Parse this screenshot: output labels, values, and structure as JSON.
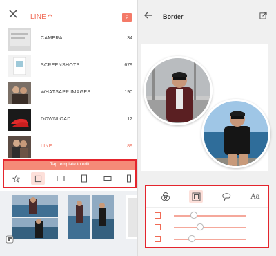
{
  "left": {
    "header": {
      "title": "LINE",
      "badge": "2",
      "close_icon": "close-icon",
      "caret_icon": "chevron-up-icon"
    },
    "albums": [
      {
        "name": "CAMERA",
        "count": "34",
        "thumb": "camera-thumbnail"
      },
      {
        "name": "SCREENSHOTS",
        "count": "679",
        "thumb": "screenshot-thumbnail"
      },
      {
        "name": "WHATSAPP IMAGES",
        "count": "190",
        "thumb": "whatsapp-thumbnail"
      },
      {
        "name": "DOWNLOAD",
        "count": "12",
        "thumb": "download-thumbnail"
      },
      {
        "name": "LINE",
        "count": "89",
        "thumb": "line-thumbnail",
        "active": true
      }
    ],
    "template_bar": "Tap template to edit",
    "template_icons": [
      "star-icon",
      "square-frame-icon",
      "landscape-frame-icon",
      "portrait-frame-icon",
      "wide-frame-icon",
      "tall-frame-icon"
    ],
    "selected_template_index": 1
  },
  "right": {
    "header": {
      "title": "Border",
      "back_icon": "arrow-left-icon",
      "open_icon": "external-link-icon"
    },
    "tool_tabs": [
      "filter-circles-icon",
      "border-frame-icon",
      "sticker-icon",
      "text-icon"
    ],
    "text_tab_label": "Aa",
    "selected_tool_index": 1,
    "sliders": [
      {
        "icon": "border-size-icon",
        "level": 0.28
      },
      {
        "icon": "border-spacing-icon",
        "level": 0.36
      },
      {
        "icon": "corner-radius-icon",
        "level": 0.25
      }
    ]
  },
  "colors": {
    "accent": "#f06a55",
    "accent_light": "#fde0da",
    "highlight_box": "#e4252d",
    "bar": "#f58a78"
  }
}
